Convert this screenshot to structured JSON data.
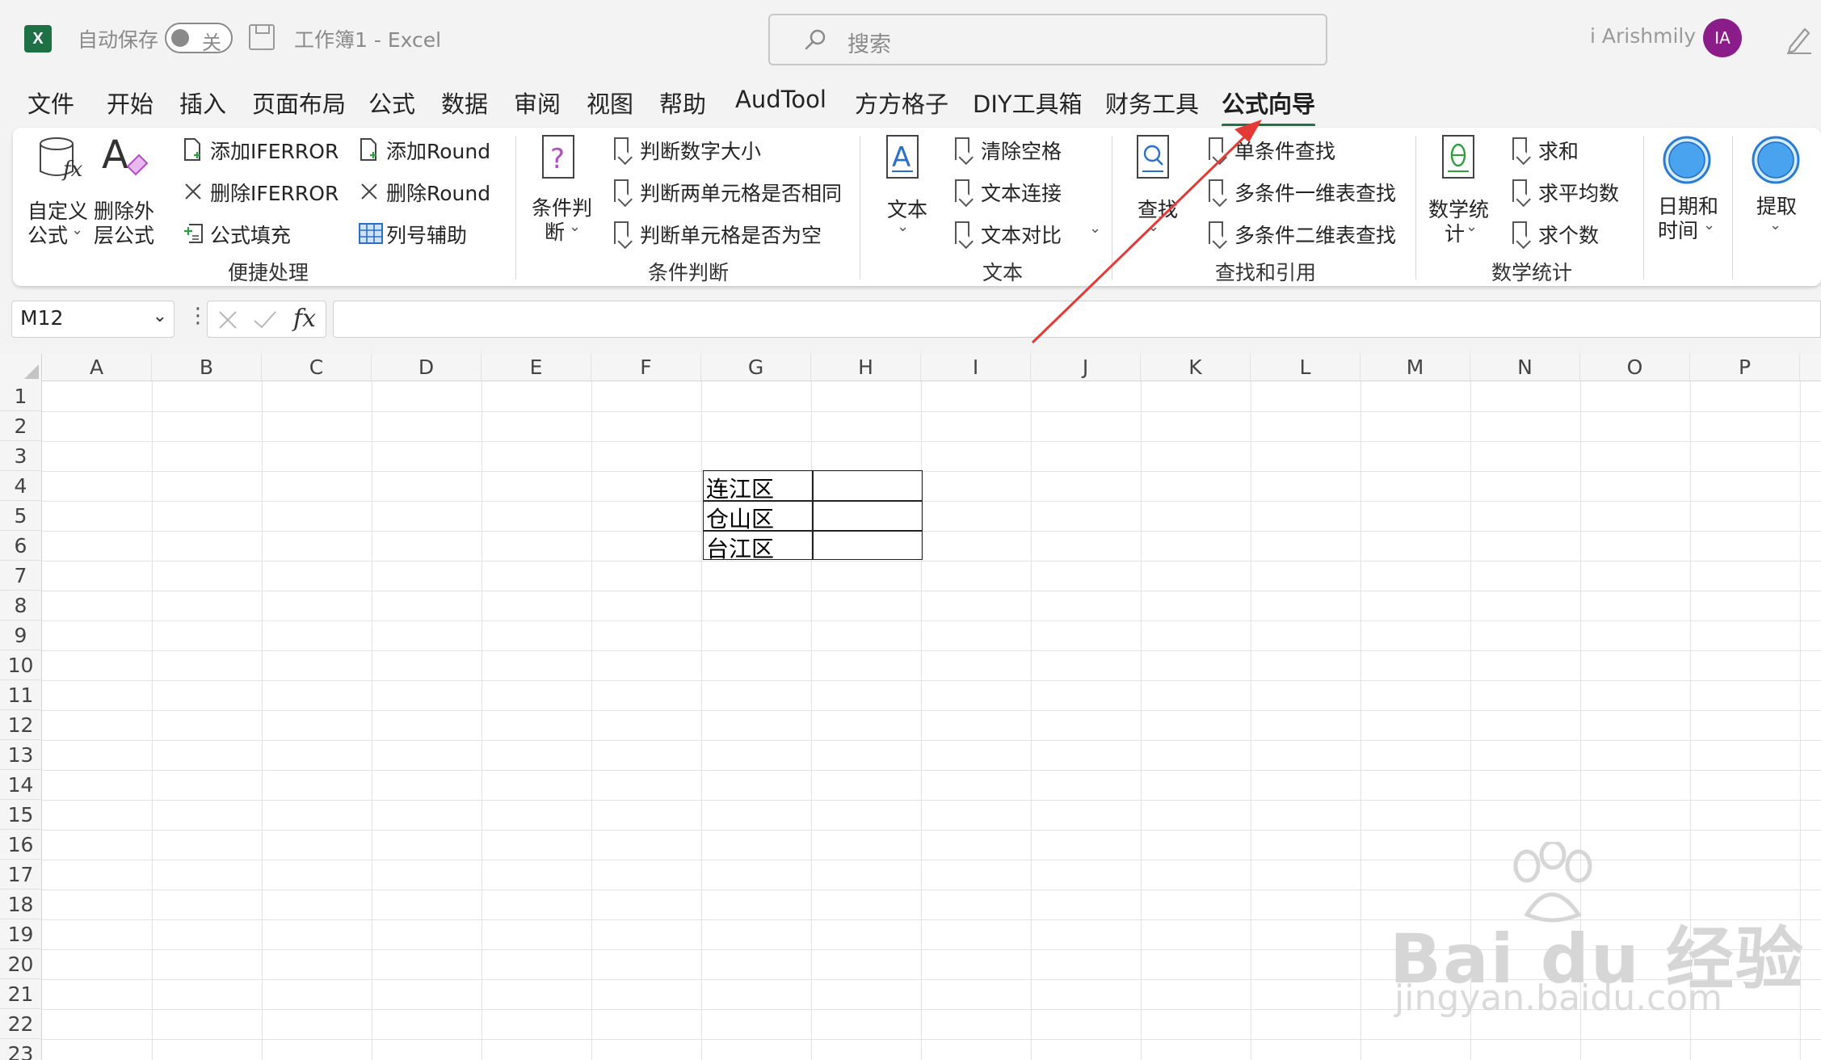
{
  "title_bar": {
    "app_logo": "X",
    "autosave_label": "自动保存",
    "autosave_state": "关",
    "document_title": "工作簿1  -  Excel",
    "search_placeholder": "搜索",
    "user_name": "i Arishmily",
    "user_initials": "IA"
  },
  "menu": {
    "tabs": [
      "文件",
      "开始",
      "插入",
      "页面布局",
      "公式",
      "数据",
      "审阅",
      "视图",
      "帮助",
      "AudTool",
      "方方格子",
      "DIY工具箱",
      "财务工具",
      "公式向导"
    ],
    "active_tab": "公式向导"
  },
  "ribbon": {
    "groups": {
      "quick": {
        "label": "便捷处理",
        "custom_formula": [
          "自定义",
          "公式"
        ],
        "remove_outer": [
          "删除外",
          "层公式"
        ],
        "add_iferror": "添加IFERROR",
        "remove_iferror": "删除IFERROR",
        "formula_fill": "公式填充",
        "add_round": "添加Round",
        "remove_round": "删除Round",
        "col_helper": "列号辅助"
      },
      "condition": {
        "label": "条件判断",
        "main": [
          "条件判",
          "断"
        ],
        "item1": "判断数字大小",
        "item2": "判断两单元格是否相同",
        "item3": "判断单元格是否为空"
      },
      "text": {
        "label": "文本",
        "main": "文本",
        "item1": "清除空格",
        "item2": "文本连接",
        "item3": "文本对比"
      },
      "lookup": {
        "label": "查找和引用",
        "main": "查找",
        "item1": "单条件查找",
        "item2": "多条件一维表查找",
        "item3": "多条件二维表查找"
      },
      "math": {
        "label": "数学统计",
        "main": [
          "数学统",
          "计"
        ],
        "item1": "求和",
        "item2": "求平均数",
        "item3": "求个数"
      },
      "datetime": {
        "main": [
          "日期和",
          "时间"
        ]
      },
      "extract": {
        "main": "提取"
      }
    }
  },
  "formula_bar": {
    "name_box": "M12",
    "formula": ""
  },
  "sheet": {
    "columns": [
      "A",
      "B",
      "C",
      "D",
      "E",
      "F",
      "G",
      "H",
      "I",
      "J",
      "K",
      "L",
      "M",
      "N",
      "O",
      "P"
    ],
    "rows": [
      "1",
      "2",
      "3",
      "4",
      "5",
      "6",
      "7",
      "8",
      "9",
      "10",
      "11",
      "12",
      "13",
      "14",
      "15",
      "16",
      "17",
      "18",
      "19",
      "20",
      "21",
      "22",
      "23"
    ],
    "cells": {
      "G4": "连江区",
      "G5": "仓山区",
      "G6": "台江区"
    }
  },
  "watermark": {
    "main": "Bai du 经验",
    "sub": "jingyan.baidu.com"
  },
  "colors": {
    "excel_green": "#217346",
    "avatar_purple": "#8a1d8a",
    "annotation_arrow": "#e53935"
  }
}
